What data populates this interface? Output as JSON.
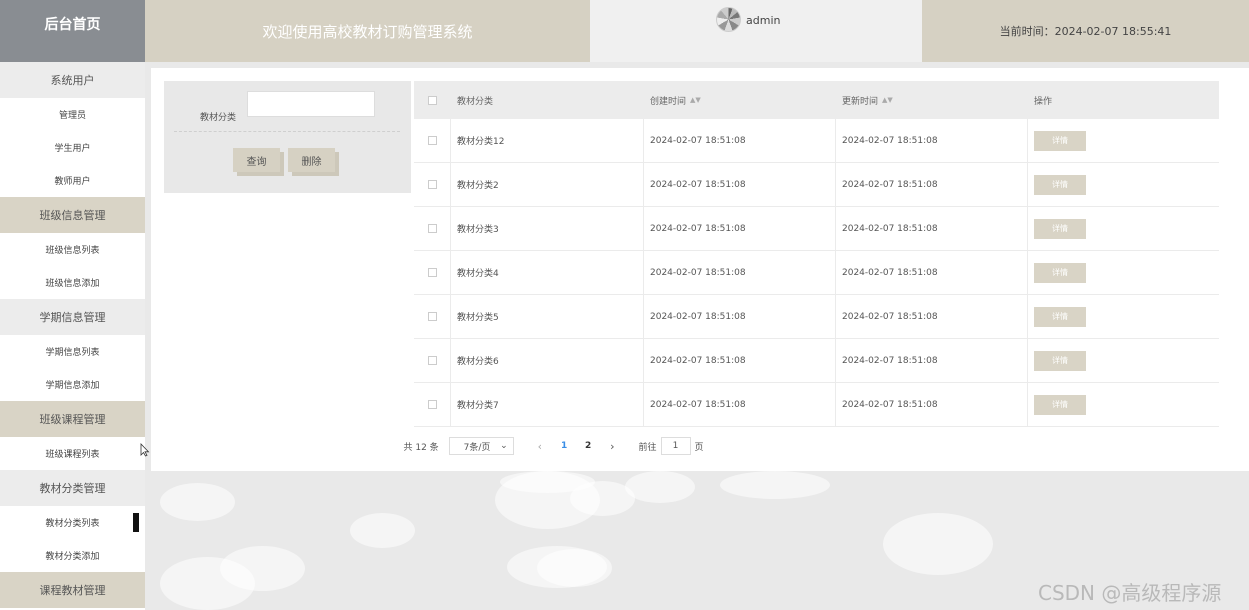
{
  "header": {
    "brand": "后台首页",
    "system_title": "欢迎使用高校教材订购管理系统",
    "username": "admin",
    "time_label": "当前时间：",
    "time_value": "2024-02-07 18:55:41"
  },
  "sidebar": {
    "items": [
      {
        "label": "系统用户",
        "type": "group",
        "shade": "light"
      },
      {
        "label": "管理员",
        "type": "item"
      },
      {
        "label": "学生用户",
        "type": "item"
      },
      {
        "label": "教师用户",
        "type": "item"
      },
      {
        "label": "班级信息管理",
        "type": "group"
      },
      {
        "label": "班级信息列表",
        "type": "item"
      },
      {
        "label": "班级信息添加",
        "type": "item"
      },
      {
        "label": "学期信息管理",
        "type": "group",
        "shade": "light"
      },
      {
        "label": "学期信息列表",
        "type": "item"
      },
      {
        "label": "学期信息添加",
        "type": "item"
      },
      {
        "label": "班级课程管理",
        "type": "group"
      },
      {
        "label": "班级课程列表",
        "type": "item"
      },
      {
        "label": "教材分类管理",
        "type": "group",
        "shade": "light"
      },
      {
        "label": "教材分类列表",
        "type": "item",
        "active": true
      },
      {
        "label": "教材分类添加",
        "type": "item"
      },
      {
        "label": "课程教材管理",
        "type": "group"
      }
    ]
  },
  "search": {
    "label": "教材分类",
    "value": "",
    "query_button": "查询",
    "delete_button": "删除"
  },
  "table": {
    "columns": [
      "教材分类",
      "创建时间",
      "更新时间",
      "操作"
    ],
    "rows": [
      {
        "category": "教材分类12",
        "created": "2024-02-07 18:51:08",
        "updated": "2024-02-07 18:51:08",
        "action": "详情"
      },
      {
        "category": "教材分类2",
        "created": "2024-02-07 18:51:08",
        "updated": "2024-02-07 18:51:08",
        "action": "详情"
      },
      {
        "category": "教材分类3",
        "created": "2024-02-07 18:51:08",
        "updated": "2024-02-07 18:51:08",
        "action": "详情"
      },
      {
        "category": "教材分类4",
        "created": "2024-02-07 18:51:08",
        "updated": "2024-02-07 18:51:08",
        "action": "详情"
      },
      {
        "category": "教材分类5",
        "created": "2024-02-07 18:51:08",
        "updated": "2024-02-07 18:51:08",
        "action": "详情"
      },
      {
        "category": "教材分类6",
        "created": "2024-02-07 18:51:08",
        "updated": "2024-02-07 18:51:08",
        "action": "详情"
      },
      {
        "category": "教材分类7",
        "created": "2024-02-07 18:51:08",
        "updated": "2024-02-07 18:51:08",
        "action": "详情"
      }
    ]
  },
  "pagination": {
    "total_text": "共 12 条",
    "page_size": "7条/页",
    "pages": [
      "1",
      "2"
    ],
    "current_page": "1",
    "goto_label": "前往",
    "goto_value": "1",
    "goto_suffix": "页"
  },
  "watermark": "CSDN @高级程序源",
  "colors": {
    "accent": "#d6d1c3",
    "brand_bg": "#898d92",
    "current_page": "#3a8ee6"
  }
}
